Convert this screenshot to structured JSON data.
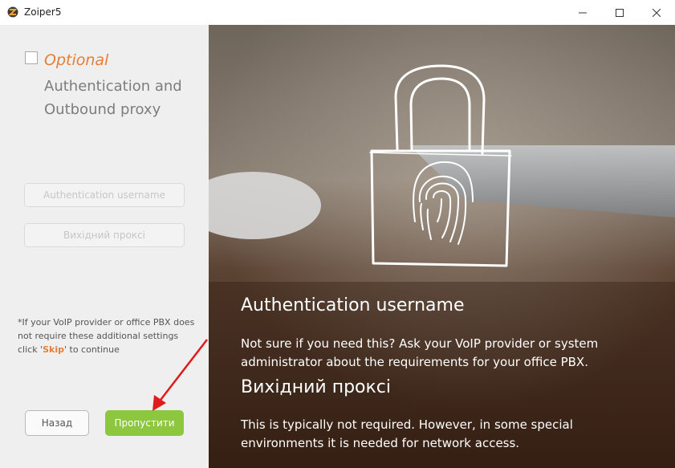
{
  "window": {
    "title": "Zoiper5",
    "icon": "zoiper-icon"
  },
  "form": {
    "optional_label": "Optional",
    "heading": "Authentication and Outbound proxy",
    "auth_username_placeholder": "Authentication username",
    "proxy_placeholder": "Вихідний проксі",
    "note_before": "*If your VoIP provider or office PBX does not require these additional settings click '",
    "note_skip": "Skip",
    "note_after": "' to continue",
    "back_label": "Назад",
    "skip_label": "Пропустити"
  },
  "info": {
    "auth_title": "Authentication username",
    "auth_text": " Not sure if you need this? Ask your VoIP provider or system administrator about the requirements for your office PBX.",
    "proxy_title": "Вихідний проксі",
    "proxy_text": " This is typically not required. However, in some special environments it is needed for network access."
  },
  "colors": {
    "accent": "#e67e35",
    "skip_button": "#8dc63f",
    "annotation_arrow": "#e01b1b"
  }
}
